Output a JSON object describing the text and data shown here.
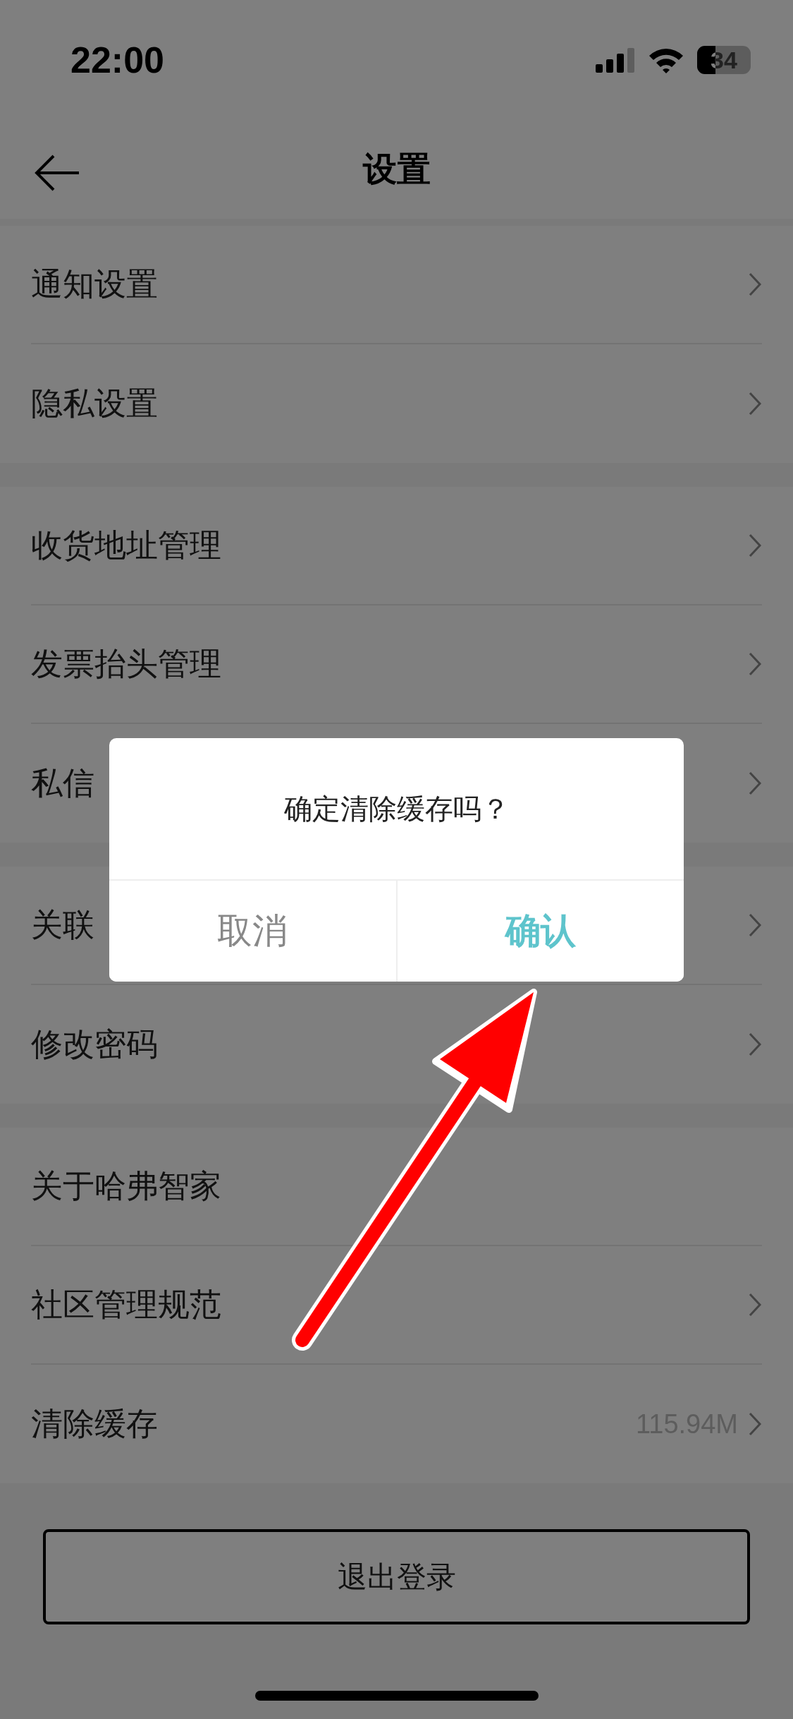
{
  "status_bar": {
    "time": "22:00",
    "battery_text": "34"
  },
  "nav": {
    "title": "设置"
  },
  "groups": [
    {
      "items": [
        {
          "label": "通知设置",
          "chevron": true
        },
        {
          "label": "隐私设置",
          "chevron": true
        }
      ]
    },
    {
      "items": [
        {
          "label": "收货地址管理",
          "chevron": true
        },
        {
          "label": "发票抬头管理",
          "chevron": true
        },
        {
          "label": "私信",
          "chevron": true
        }
      ]
    },
    {
      "items": [
        {
          "label": "关联",
          "chevron": true
        },
        {
          "label": "修改密码",
          "chevron": true
        }
      ]
    },
    {
      "items": [
        {
          "label": "关于哈弗智家",
          "chevron": false
        },
        {
          "label": "社区管理规范",
          "chevron": true
        },
        {
          "label": "清除缓存",
          "value": "115.94M",
          "chevron": true
        }
      ]
    }
  ],
  "logout_button": "退出登录",
  "dialog": {
    "message": "确定清除缓存吗？",
    "buttons": [
      {
        "label": "取消",
        "kind": "cancel"
      },
      {
        "label": "确认",
        "kind": "confirm"
      }
    ]
  }
}
